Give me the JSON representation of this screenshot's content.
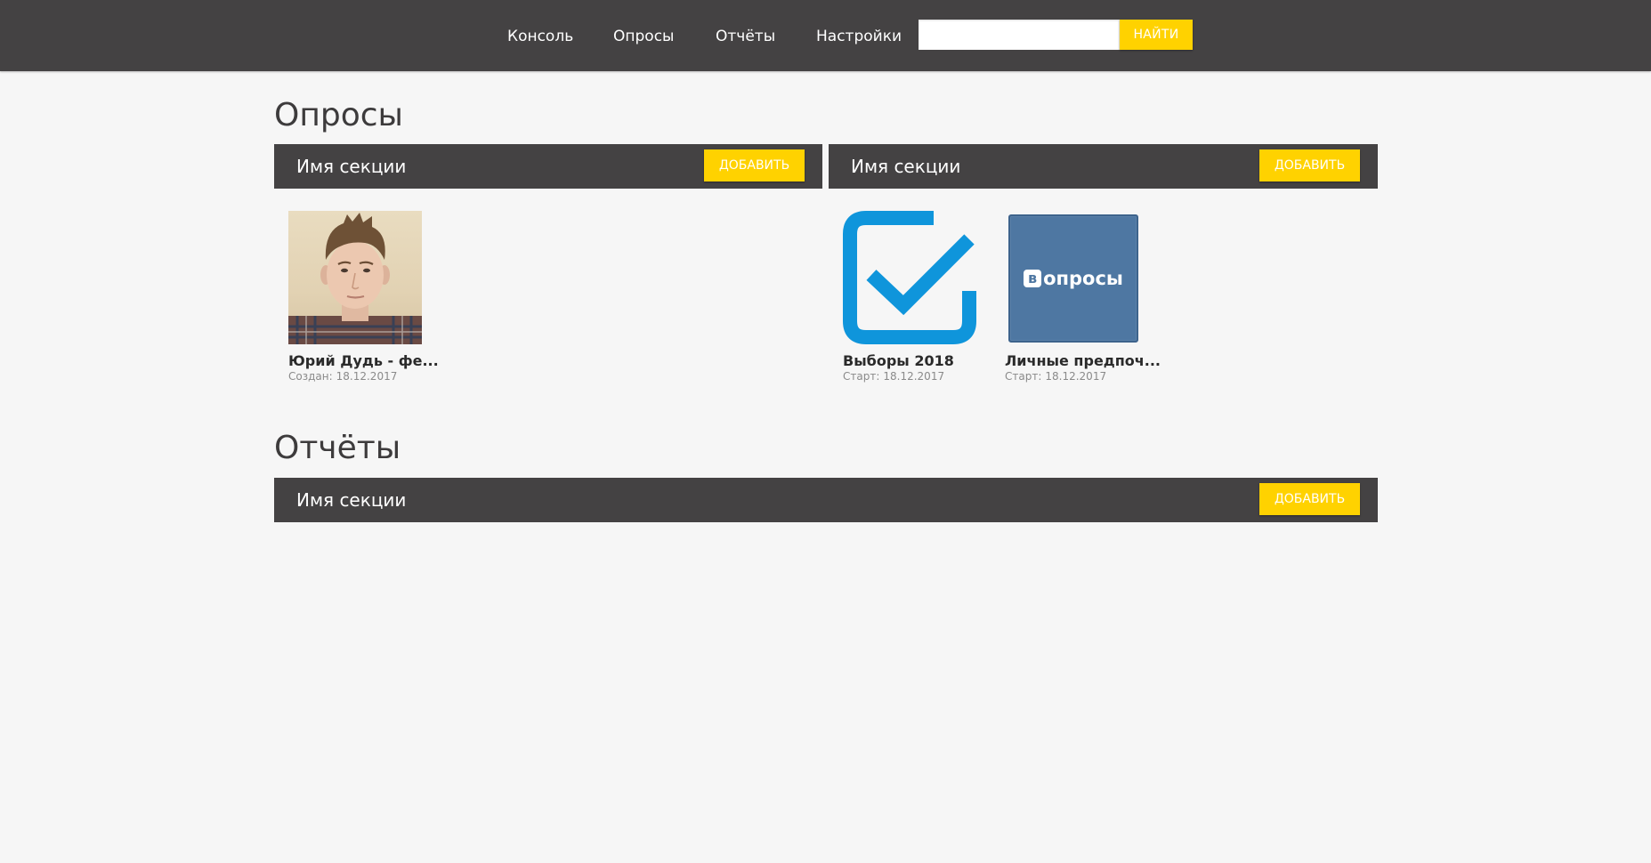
{
  "nav": {
    "items": [
      {
        "label": "Консоль"
      },
      {
        "label": "Опросы"
      },
      {
        "label": "Отчёты"
      },
      {
        "label": "Настройки"
      }
    ],
    "search": {
      "value": "",
      "placeholder": "",
      "button_label": "Найти"
    }
  },
  "polls": {
    "heading": "Опросы",
    "sections": [
      {
        "title": "Имя секции",
        "add_label": "Добавить",
        "cards": [
          {
            "title": "Юрий Дудь - фе...",
            "meta_label": "Создан:",
            "date": "18.12.2017",
            "icon": "person-photo"
          }
        ]
      },
      {
        "title": "Имя секции",
        "add_label": "Добавить",
        "cards": [
          {
            "title": "Выборы 2018",
            "meta_label": "Старт:",
            "date": "18.12.2017",
            "icon": "checkbox-icon"
          },
          {
            "title": "Личные предпоч...",
            "meta_label": "Старт:",
            "date": "18.12.2017",
            "icon": "vk-polls-logo",
            "logo_text": "опросы",
            "logo_letter": "в"
          }
        ]
      }
    ]
  },
  "reports": {
    "heading": "Отчёты",
    "sections": [
      {
        "title": "Имя секции",
        "add_label": "Добавить"
      }
    ]
  },
  "colors": {
    "topbar": "#444243",
    "accent": "#ffd200",
    "background": "#f6f6f6",
    "checkbox_blue": "#0f95db",
    "vk_blue": "#4e77a2"
  }
}
